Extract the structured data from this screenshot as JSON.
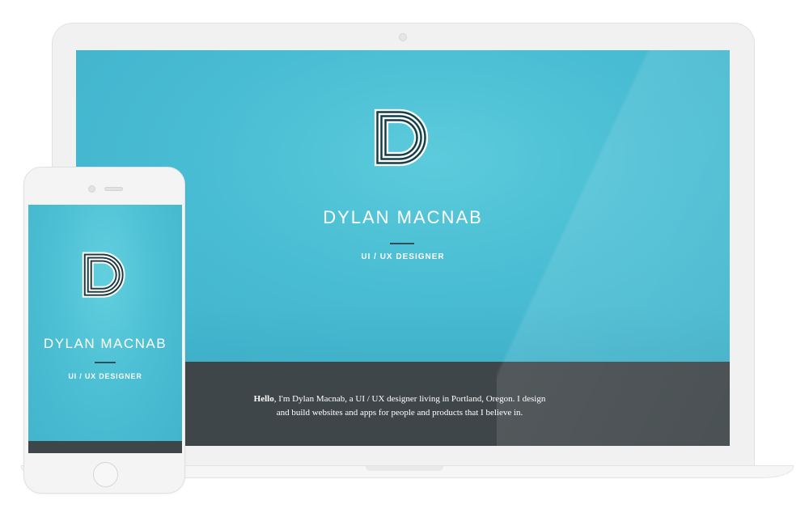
{
  "laptop": {
    "name": "DYLAN MACNAB",
    "role": "UI / UX DESIGNER",
    "intro_lead": "Hello",
    "intro_line1": ", I'm Dylan Macnab, a UI / UX designer living in Portland, Oregon. I design",
    "intro_line2": "and build websites and apps for people and products that I believe in."
  },
  "phone": {
    "name": "DYLAN MACNAB",
    "role": "UI / UX DESIGNER"
  },
  "colors": {
    "hero": "#4bbfd4",
    "band": "#3f4649",
    "rule": "#2f4e58"
  },
  "icons": {
    "logo": "d-monogram-logo",
    "camera": "camera-icon",
    "home": "home-button-icon"
  }
}
